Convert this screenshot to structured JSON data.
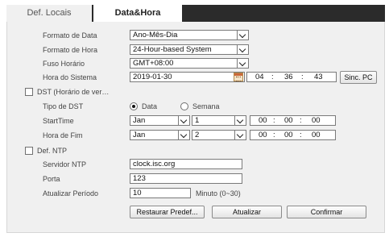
{
  "tabs": [
    {
      "label": "Def. Locais"
    },
    {
      "label": "Data&Hora"
    }
  ],
  "date_format": {
    "label": "Formato de Data",
    "value": "Ano-Mês-Dia"
  },
  "time_format": {
    "label": "Formato de Hora",
    "value": "24-Hour-based System"
  },
  "timezone": {
    "label": "Fuso Horário",
    "value": "GMT+08:00"
  },
  "system_time": {
    "label": "Hora do Sistema",
    "date": "2019-01-30",
    "hour": "04",
    "minute": "36",
    "second": "43",
    "sep": ":",
    "sync_pc_label": "Sinc. PC"
  },
  "dst": {
    "label": "DST (Horário de ver…",
    "type_label": "Tipo de DST",
    "options": [
      "Data",
      "Semana"
    ],
    "selected": "Data",
    "start": {
      "label": "StartTime",
      "month": "Jan",
      "day": "1",
      "hour": "00",
      "minute": "00",
      "second": "00"
    },
    "end": {
      "label": "Hora de Fim",
      "month": "Jan",
      "day": "2",
      "hour": "00",
      "minute": "00",
      "second": "00"
    }
  },
  "ntp": {
    "label": "Def. NTP",
    "server_label": "Servidor NTP",
    "server_value": "clock.isc.org",
    "port_label": "Porta",
    "port_value": "123",
    "period_label": "Atualizar Período",
    "period_value": "10",
    "period_unit": "Minuto (0~30)"
  },
  "buttons": {
    "restore": "Restaurar Predef...",
    "refresh": "Atualizar",
    "confirm": "Confirmar"
  }
}
